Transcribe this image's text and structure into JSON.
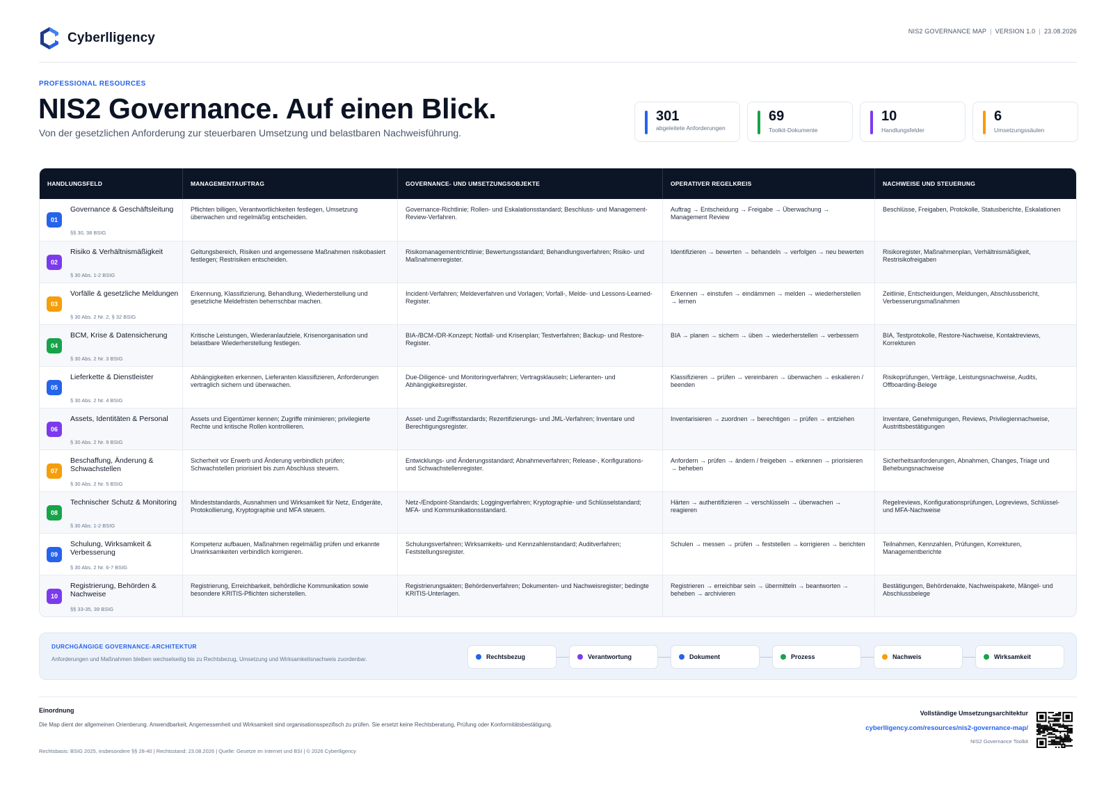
{
  "brand": {
    "name": "Cyberlligency",
    "accent": "#2563eb"
  },
  "meta": {
    "doc": "NIS2 GOVERNANCE MAP",
    "version": "VERSION 1.0",
    "date": "23.08.2026",
    "separator": "|"
  },
  "hero": {
    "eyebrow": "PROFESSIONAL RESOURCES",
    "title": "NIS2 Governance. Auf einen Blick.",
    "subtitle": "Von der gesetzlichen Anforderung zur steuerbaren Umsetzung und belastbaren Nachweisführung."
  },
  "stats": [
    {
      "value": "301",
      "label": "abgeleitete Anforderungen",
      "color": "#2563eb"
    },
    {
      "value": "69",
      "label": "Toolkit-Dokumente",
      "color": "#16a34a"
    },
    {
      "value": "10",
      "label": "Handlungsfelder",
      "color": "#7c3aed"
    },
    {
      "value": "6",
      "label": "Umsetzungssäulen",
      "color": "#f59e0b"
    }
  ],
  "table": {
    "headers": [
      "HANDLUNGSFELD",
      "MANAGEMENTAUFTRAG",
      "GOVERNANCE- UND UMSETZUNGSOBJEKTE",
      "OPERATIVER REGELKREIS",
      "NACHWEISE UND STEUERUNG"
    ],
    "rows": [
      {
        "num": "01",
        "color": "#2563eb",
        "field": "Governance & Geschäftsleitung",
        "ref": "§§ 30, 38 BSIG",
        "mandate": "Pflichten billigen, Verantwortlichkeiten festlegen, Umsetzung überwachen und regelmäßig entscheiden.",
        "objects": "Governance-Richtlinie; Rollen- und Eskalationsstandard; Beschluss- und Management-Review-Verfahren.",
        "cycle": "Auftrag → Entscheidung → Freigabe → Überwachung → Management Review",
        "evidence": "Beschlüsse, Freigaben, Protokolle, Statusberichte, Eskalationen"
      },
      {
        "num": "02",
        "color": "#7c3aed",
        "field": "Risiko & Verhältnismäßigkeit",
        "ref": "§ 30 Abs. 1-2 BSIG",
        "mandate": "Geltungsbereich, Risiken und angemessene Maßnahmen risikobasiert festlegen; Restrisiken entscheiden.",
        "objects": "Risikomanagementrichtlinie; Bewertungsstandard; Behandlungsverfahren; Risiko- und Maßnahmenregister.",
        "cycle": "Identifizieren → bewerten → behandeln → verfolgen → neu bewerten",
        "evidence": "Risikoregister, Maßnahmenplan, Verhältnismäßigkeit, Restrisikofreigaben"
      },
      {
        "num": "03",
        "color": "#f59e0b",
        "field": "Vorfälle & gesetzliche Meldungen",
        "ref": "§ 30 Abs. 2 Nr. 2, § 32 BSIG",
        "mandate": "Erkennung, Klassifizierung, Behandlung, Wiederherstellung und gesetzliche Meldefristen beherrschbar machen.",
        "objects": "Incident-Verfahren; Meldeverfahren und Vorlagen; Vorfall-, Melde- und Lessons-Learned-Register.",
        "cycle": "Erkennen → einstufen → eindämmen → melden → wiederherstellen → lernen",
        "evidence": "Zeitlinie, Entscheidungen, Meldungen, Abschlussbericht, Verbesserungsmaßnahmen"
      },
      {
        "num": "04",
        "color": "#16a34a",
        "field": "BCM, Krise & Datensicherung",
        "ref": "§ 30 Abs. 2 Nr. 3 BSIG",
        "mandate": "Kritische Leistungen, Wiederanlaufziele, Krisenorganisation und belastbare Wiederherstellung festlegen.",
        "objects": "BIA-/BCM-/DR-Konzept; Notfall- und Krisenplan; Testverfahren; Backup- und Restore-Register.",
        "cycle": "BIA → planen → sichern → üben → wiederherstellen → verbessern",
        "evidence": "BIA, Testprotokolle, Restore-Nachweise, Kontaktreviews, Korrekturen"
      },
      {
        "num": "05",
        "color": "#2563eb",
        "field": "Lieferkette & Dienstleister",
        "ref": "§ 30 Abs. 2 Nr. 4 BSIG",
        "mandate": "Abhängigkeiten erkennen, Lieferanten klassifizieren, Anforderungen vertraglich sichern und überwachen.",
        "objects": "Due-Diligence- und Monitoringverfahren; Vertragsklauseln; Lieferanten- und Abhängigkeitsregister.",
        "cycle": "Klassifizieren → prüfen → vereinbaren → überwachen → eskalieren / beenden",
        "evidence": "Risikoprüfungen, Verträge, Leistungsnachweise, Audits, Offboarding-Belege"
      },
      {
        "num": "06",
        "color": "#7c3aed",
        "field": "Assets, Identitäten & Personal",
        "ref": "§ 30 Abs. 2 Nr. 9 BSIG",
        "mandate": "Assets und Eigentümer kennen; Zugriffe minimieren; privilegierte Rechte und kritische Rollen kontrollieren.",
        "objects": "Asset- und Zugriffsstandards; Rezertifizierungs- und JML-Verfahren; Inventare und Berechtigungsregister.",
        "cycle": "Inventarisieren → zuordnen → berechtigen → prüfen → entziehen",
        "evidence": "Inventare, Genehmigungen, Reviews, Privilegiennachweise, Austrittsbestätigungen"
      },
      {
        "num": "07",
        "color": "#f59e0b",
        "field": "Beschaffung, Änderung & Schwachstellen",
        "ref": "§ 30 Abs. 2 Nr. 5 BSIG",
        "mandate": "Sicherheit vor Erwerb und Änderung verbindlich prüfen; Schwachstellen priorisiert bis zum Abschluss steuern.",
        "objects": "Entwicklungs- und Änderungsstandard; Abnahmeverfahren; Release-, Konfigurations- und Schwachstellenregister.",
        "cycle": "Anfordern → prüfen → ändern / freigeben → erkennen → priorisieren → beheben",
        "evidence": "Sicherheitsanforderungen, Abnahmen, Changes, Triage und Behebungsnachweise"
      },
      {
        "num": "08",
        "color": "#16a34a",
        "field": "Technischer Schutz & Monitoring",
        "ref": "§ 30 Abs. 1-2 BSIG",
        "mandate": "Mindeststandards, Ausnahmen und Wirksamkeit für Netz, Endgeräte, Protokollierung, Kryptographie und MFA steuern.",
        "objects": "Netz-/Endpoint-Standards; Loggingverfahren; Kryptographie- und Schlüsselstandard; MFA- und Kommunikationsstandard.",
        "cycle": "Härten → authentifizieren → verschlüsseln → überwachen → reagieren",
        "evidence": "Regelreviews, Konfigurationsprüfungen, Logreviews, Schlüssel- und MFA-Nachweise"
      },
      {
        "num": "09",
        "color": "#2563eb",
        "field": "Schulung, Wirksamkeit & Verbesserung",
        "ref": "§ 30 Abs. 2 Nr. 6-7 BSIG",
        "mandate": "Kompetenz aufbauen, Maßnahmen regelmäßig prüfen und erkannte Unwirksamkeiten verbindlich korrigieren.",
        "objects": "Schulungsverfahren; Wirksamkeits- und Kennzahlenstandard; Auditverfahren; Feststellungsregister.",
        "cycle": "Schulen → messen → prüfen → feststellen → korrigieren → berichten",
        "evidence": "Teilnahmen, Kennzahlen, Prüfungen, Korrekturen, Managementberichte"
      },
      {
        "num": "10",
        "color": "#7c3aed",
        "field": "Registrierung, Behörden & Nachweise",
        "ref": "§§ 33-35, 39 BSIG",
        "mandate": "Registrierung, Erreichbarkeit, behördliche Kommunikation sowie besondere KRITIS-Pflichten sicherstellen.",
        "objects": "Registrierungsakten; Behördenverfahren; Dokumenten- und Nachweisregister; bedingte KRITIS-Unterlagen.",
        "cycle": "Registrieren → erreichbar sein → übermitteln → beantworten → beheben → archivieren",
        "evidence": "Bestätigungen, Behördenakte, Nachweispakete, Mängel- und Abschlussbelege"
      }
    ]
  },
  "architecture": {
    "title": "DURCHGÄNGIGE GOVERNANCE-ARCHITEKTUR",
    "text": "Anforderungen und Maßnahmen bleiben wechselseitig bis zu Rechtsbezug, Umsetzung und Wirksamkeitsnachweis zuordenbar.",
    "pillars": [
      {
        "label": "Rechtsbezug",
        "color": "#2563eb"
      },
      {
        "label": "Verantwortung",
        "color": "#7c3aed"
      },
      {
        "label": "Dokument",
        "color": "#2563eb"
      },
      {
        "label": "Prozess",
        "color": "#16a34a"
      },
      {
        "label": "Nachweis",
        "color": "#f59e0b"
      },
      {
        "label": "Wirksamkeit",
        "color": "#16a34a"
      }
    ]
  },
  "footer": {
    "heading": "Einordnung",
    "text": "Die Map dient der allgemeinen Orientierung. Anwendbarkeit, Angemessenheit und Wirksamkeit sind organisationsspezifisch zu prüfen. Sie ersetzt keine Rechtsberatung, Prüfung oder Konformitätsbestätigung.",
    "legal": "Rechtsbasis: BSIG 2025, insbesondere §§ 28-40 | Rechtsstand: 23.08.2026 | Quelle: Gesetze im Internet und BSI | © 2026 Cyberlligency",
    "cta_heading": "Vollständige Umsetzungsarchitektur",
    "link": "cyberlligency.com/resources/nis2-governance-map/",
    "link_sub": "NIS2 Governance Toolkit"
  }
}
